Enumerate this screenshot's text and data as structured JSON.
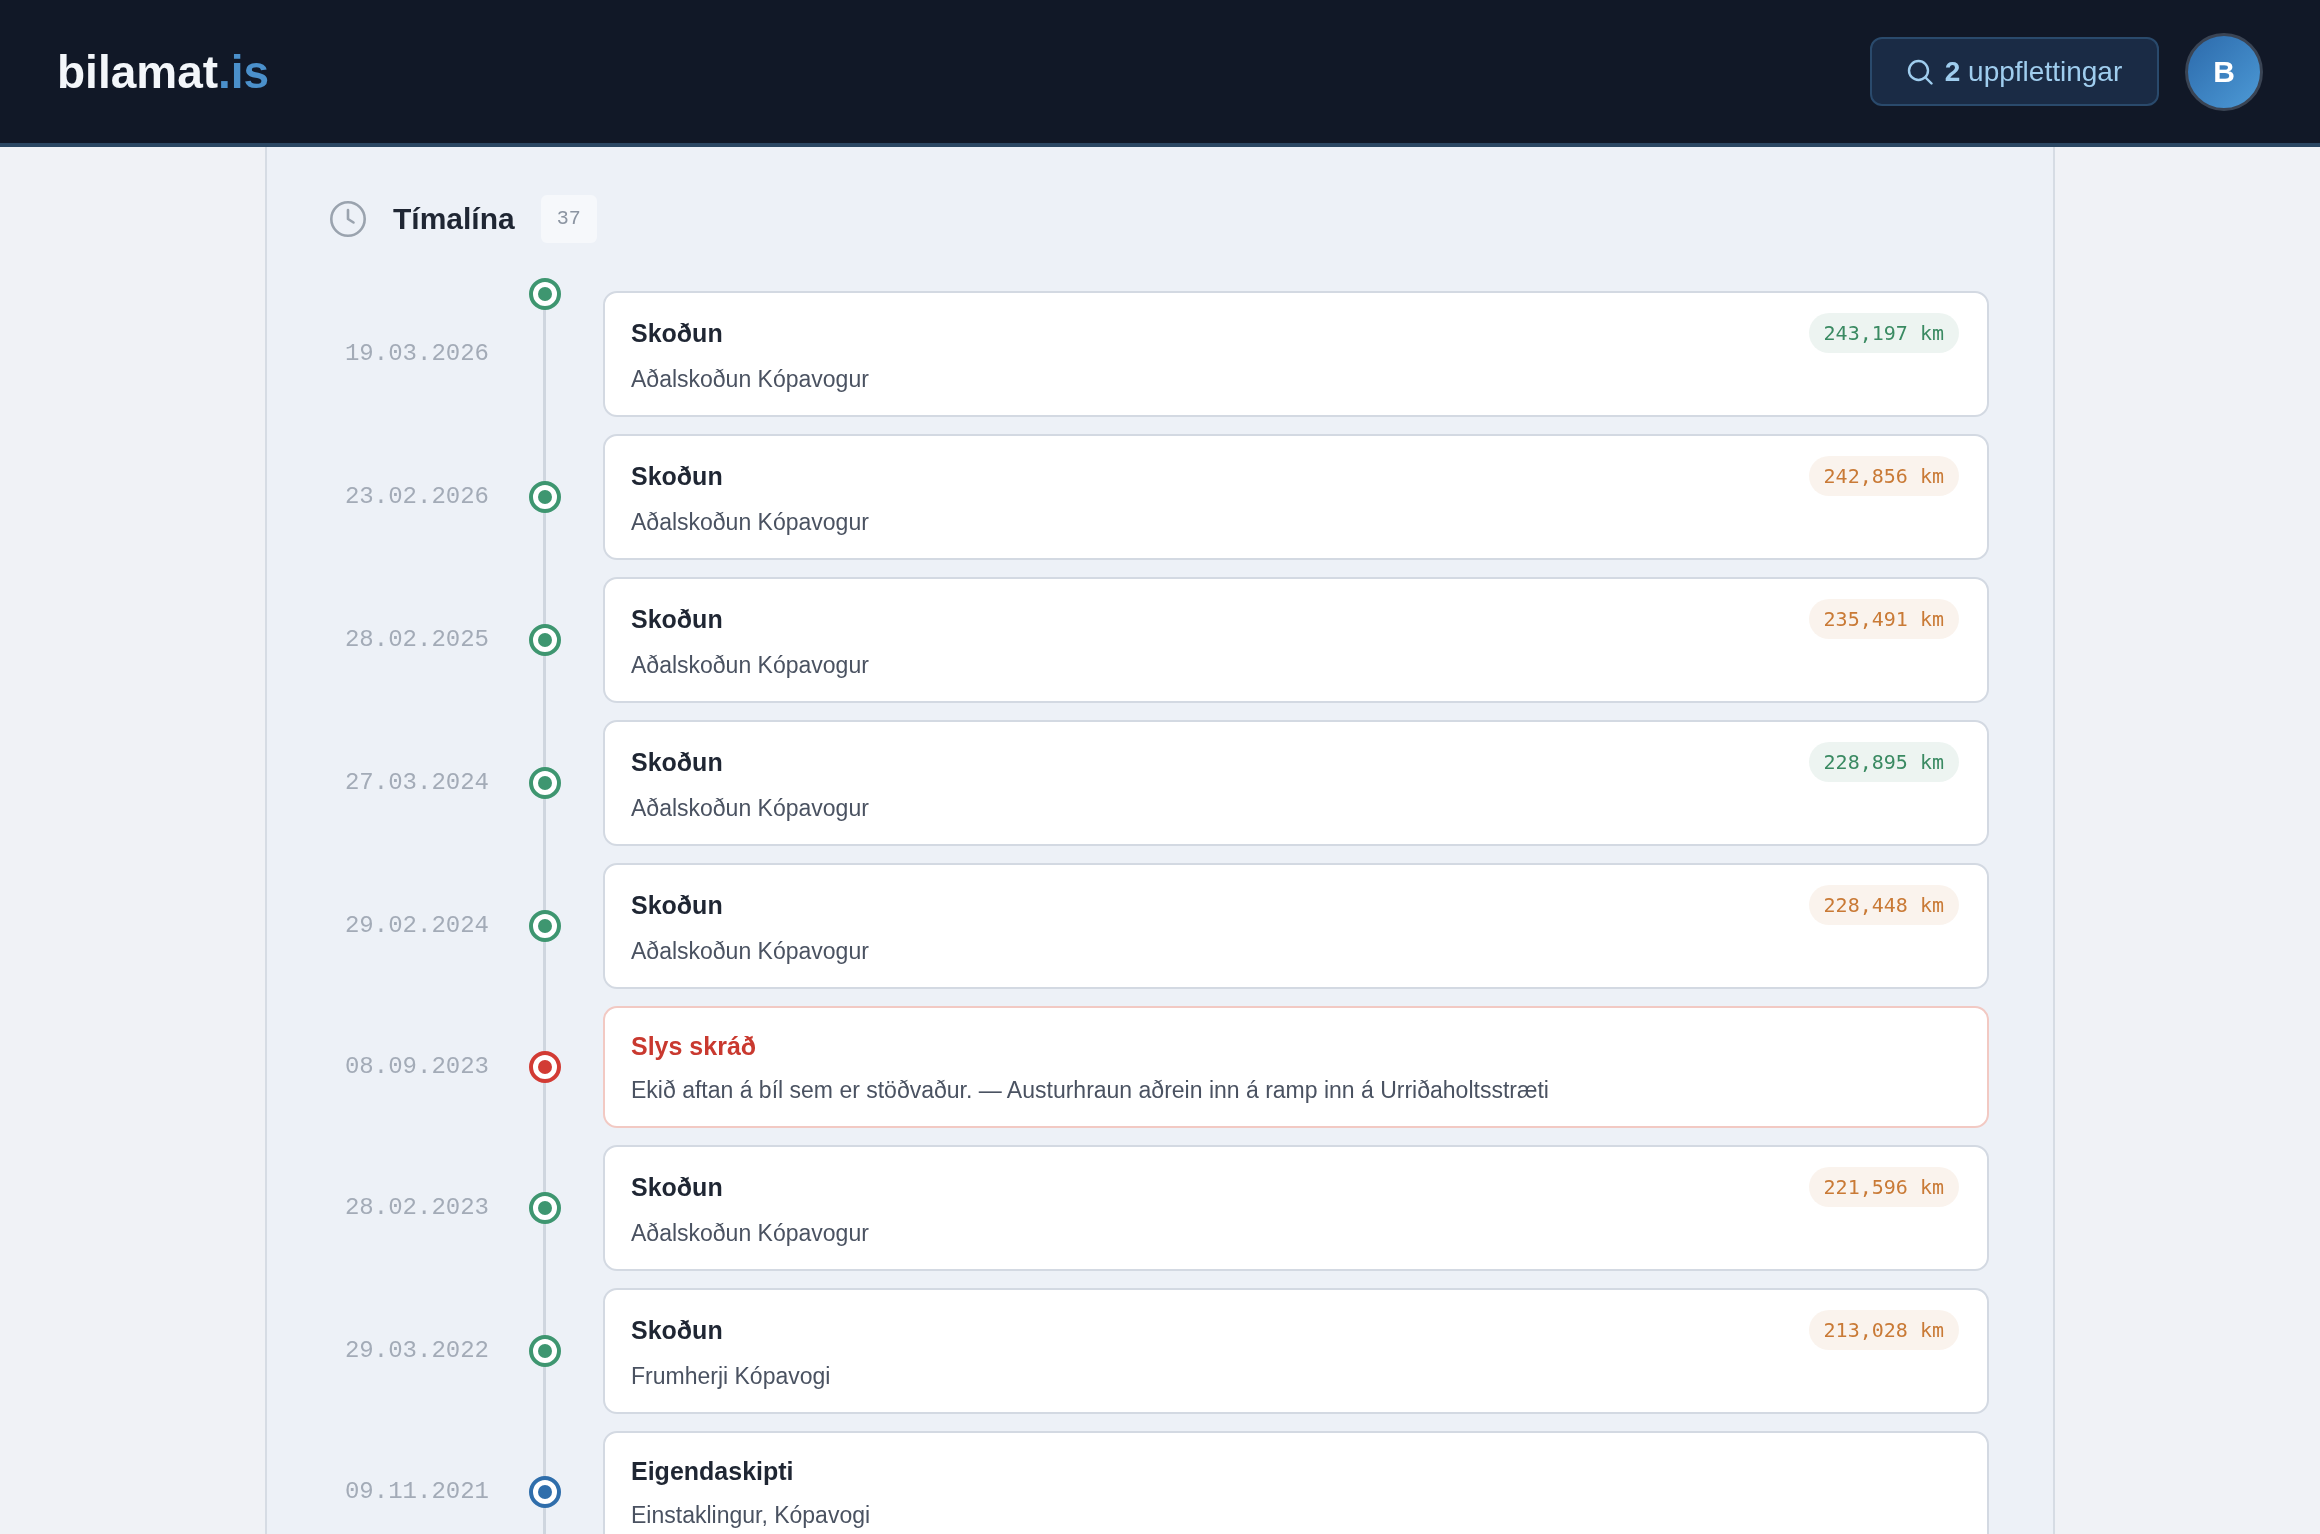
{
  "header": {
    "logo": {
      "text": "bilamat",
      "accent": ".is"
    },
    "lookups": {
      "label": "**2** uppflettingar"
    },
    "avatar": {
      "initial": "B"
    }
  },
  "timeline": {
    "title": "Tímalína",
    "count": "37",
    "events": [
      {
        "date": "19.03.2026",
        "kind": "inspection",
        "color": "#3e9670",
        "title": "Skoðun",
        "detail": "Aðalskoðun Kópavogur",
        "mileage": {
          "text": "243,197 km",
          "color": "#3a8a62"
        }
      },
      {
        "date": "23.02.2026",
        "kind": "inspection",
        "color": "#3e9670",
        "title": "Skoðun",
        "detail": "Aðalskoðun Kópavogur",
        "mileage": {
          "text": "242,856 km",
          "color": "#c97a36"
        }
      },
      {
        "date": "28.02.2025",
        "kind": "inspection",
        "color": "#3e9670",
        "title": "Skoðun",
        "detail": "Aðalskoðun Kópavogur",
        "mileage": {
          "text": "235,491 km",
          "color": "#c97a36"
        }
      },
      {
        "date": "27.03.2024",
        "kind": "inspection",
        "color": "#3e9670",
        "title": "Skoðun",
        "detail": "Aðalskoðun Kópavogur",
        "mileage": {
          "text": "228,895 km",
          "color": "#3a8a62"
        }
      },
      {
        "date": "29.02.2024",
        "kind": "inspection",
        "color": "#3e9670",
        "title": "Skoðun",
        "detail": "Aðalskoðun Kópavogur",
        "mileage": {
          "text": "228,448 km",
          "color": "#c97a36"
        }
      },
      {
        "date": "08.09.2023",
        "kind": "accident",
        "color": "#d23b34",
        "title": "Slys skráð",
        "detail": "Ekið aftan á bíl sem er stöðvaður. — Austurhraun aðrein inn á ramp inn á Urriðaholtsstræti"
      },
      {
        "date": "28.02.2023",
        "kind": "inspection",
        "color": "#3e9670",
        "title": "Skoðun",
        "detail": "Aðalskoðun Kópavogur",
        "mileage": {
          "text": "221,596 km",
          "color": "#c97a36"
        }
      },
      {
        "date": "29.03.2022",
        "kind": "inspection",
        "color": "#3e9670",
        "title": "Skoðun",
        "detail": "Frumherji Kópavogi",
        "mileage": {
          "text": "213,028 km",
          "color": "#c97a36"
        }
      },
      {
        "date": "09.11.2021",
        "kind": "ownership",
        "color": "#2f6eab",
        "title": "Eigendaskipti",
        "detail": "Einstaklingur, Kópavogi"
      }
    ]
  }
}
